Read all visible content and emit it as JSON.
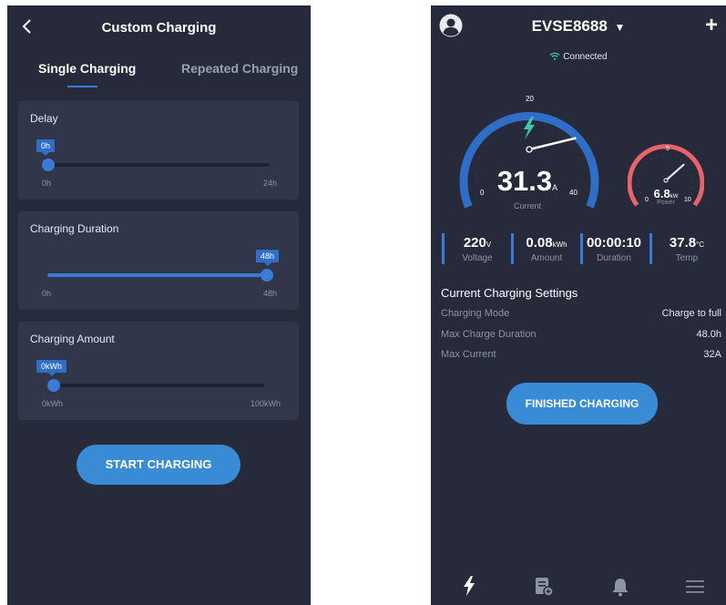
{
  "left": {
    "header": {
      "title": "Custom Charging"
    },
    "tabs": [
      {
        "label": "Single Charging"
      },
      {
        "label": "Repeated Charging"
      }
    ],
    "delay": {
      "title": "Delay",
      "value_label": "0h",
      "min": "0h",
      "max": "24h",
      "fraction": 0.0
    },
    "duration": {
      "title": "Charging Duration",
      "value_label": "48h",
      "min": "0h",
      "max": "48h",
      "fraction": 1.0
    },
    "amount": {
      "title": "Charging Amount",
      "value_label": "0kWh",
      "min": "0kWh",
      "max": "100kWh",
      "fraction": 0.0
    },
    "start_button": "START CHARGING"
  },
  "right": {
    "header": {
      "device": "EVSE8688",
      "caret": "▼",
      "add": "+"
    },
    "status": "Connected",
    "current_gauge": {
      "value": "31.3",
      "unit": "A",
      "label": "Current",
      "min": "0",
      "mid": "20",
      "max": "40",
      "reading": 31.3,
      "range": 40
    },
    "power_gauge": {
      "value": "6.8",
      "unit": "kW",
      "label": "Power",
      "min": "0",
      "mid": "5",
      "max": "10",
      "reading": 6.8,
      "range": 10
    },
    "stats": [
      {
        "value": "220",
        "unit": "V",
        "label": "Voltage"
      },
      {
        "value": "0.08",
        "unit": "kWh",
        "label": "Amount"
      },
      {
        "value": "00:00:10",
        "unit": "",
        "label": "Duration"
      },
      {
        "value": "37.8",
        "unit": "°C",
        "label": "Temp"
      }
    ],
    "settings": {
      "title": "Current Charging Settings",
      "rows": [
        {
          "key": "Charging Mode",
          "value": "Charge to full"
        },
        {
          "key": "Max Charge Duration",
          "value": "48.0h"
        },
        {
          "key": "Max Current",
          "value": "32A"
        }
      ]
    },
    "finish_button": "FINISHED CHARGING",
    "nav_icons": [
      "lightning-icon",
      "document-add-icon",
      "bell-icon",
      "menu-icon"
    ]
  }
}
